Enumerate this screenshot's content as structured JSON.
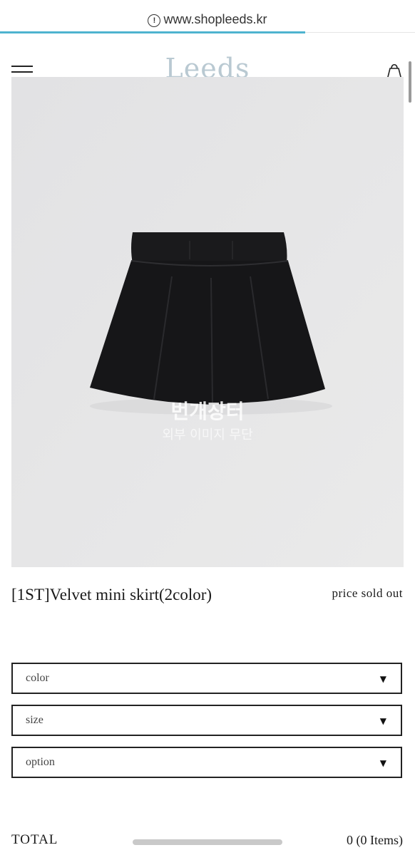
{
  "browser": {
    "url": "www.shopleeds.kr",
    "page_load_progress": 0.735
  },
  "header": {
    "logo": "Leeds",
    "icons": [
      "menu-icon",
      "shopping-bag-icon",
      "heart-icon"
    ]
  },
  "product": {
    "name": "[1ST]Velvet mini skirt(2color)",
    "price": "price sold out",
    "image_watermark": "번개장터",
    "image_watermark_sub": "외부 이미지 무단"
  },
  "options": [
    {
      "label": "color",
      "selected": ""
    },
    {
      "label": "size",
      "selected": ""
    },
    {
      "label": "option",
      "selected": ""
    }
  ],
  "total": {
    "label": "TOTAL",
    "value": "0 (0 Items)"
  },
  "colors": {
    "accent_progress": "#4eb3cf",
    "logo": "#b9c9d2",
    "image_background": "#e6e6e6"
  }
}
